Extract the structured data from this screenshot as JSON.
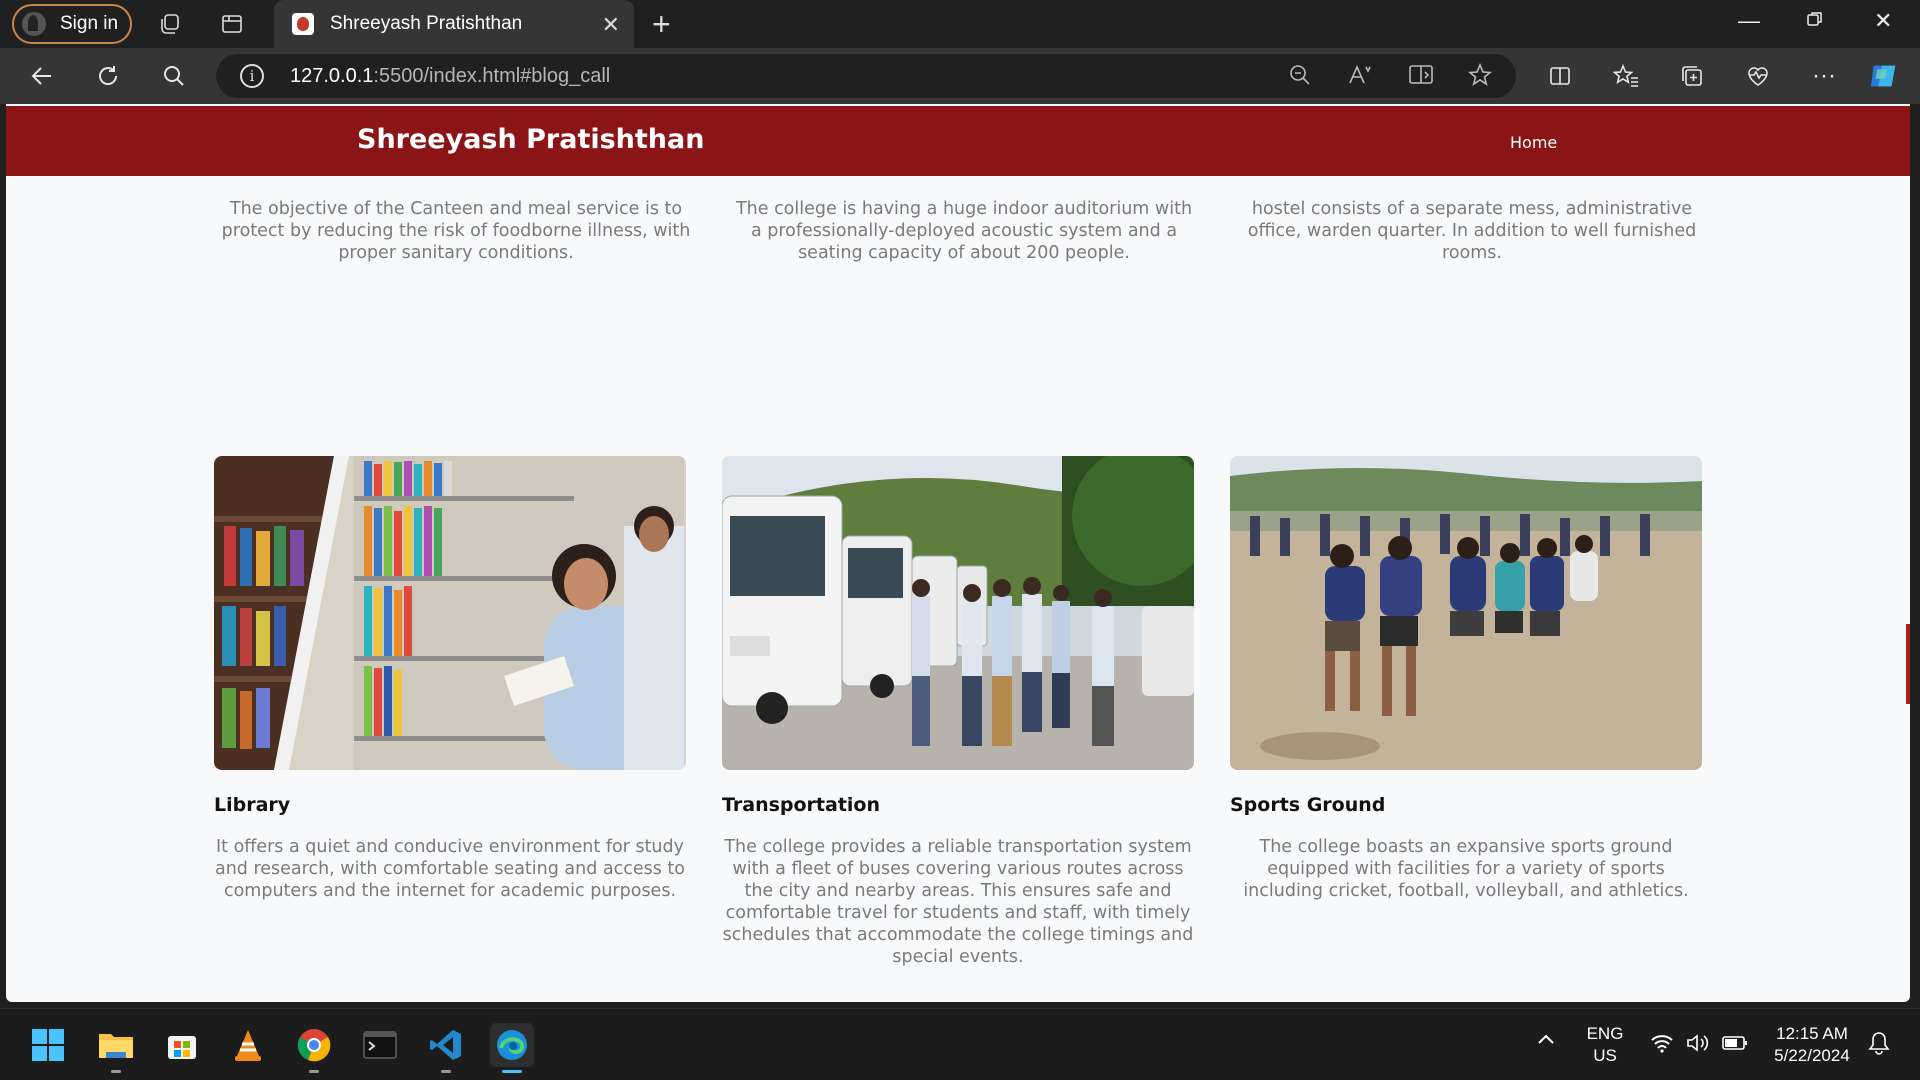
{
  "browser": {
    "sign_in_label": "Sign in",
    "tab_title": "Shreeyash Pratishthan",
    "url_host": "127.0.0.1",
    "url_rest": ":5500/index.html#blog_call"
  },
  "site": {
    "brand": "Shreeyash Pratishthan",
    "nav": {
      "home": "Home"
    },
    "top_descriptions": [
      "The objective of the Canteen and meal service is to protect by reducing the risk of foodborne illness, with proper sanitary conditions.",
      "The college is having a huge indoor auditorium with a professionally-deployed acoustic system and a seating capacity of about 200 people.",
      "hostel consists of a separate mess, administrative office, warden quarter. In addition to well furnished rooms."
    ],
    "cards": [
      {
        "title": "Library",
        "text": "It offers a quiet and conducive environment for study and research, with comfortable seating and access to computers and the internet for academic purposes."
      },
      {
        "title": "Transportation",
        "text": "The college provides a reliable transportation system with a fleet of buses covering various routes across the city and nearby areas. This ensures safe and comfortable travel for students and staff, with timely schedules that accommodate the college timings and special events."
      },
      {
        "title": "Sports Ground",
        "text": "The college boasts an expansive sports ground equipped with facilities for a variety of sports including cricket, football, volleyball, and athletics."
      }
    ],
    "colors": {
      "header": "#8b1516",
      "text_muted": "#7a7a7a"
    }
  },
  "taskbar": {
    "lang_1": "ENG",
    "lang_2": "US",
    "time": "12:15 AM",
    "date": "5/22/2024"
  }
}
